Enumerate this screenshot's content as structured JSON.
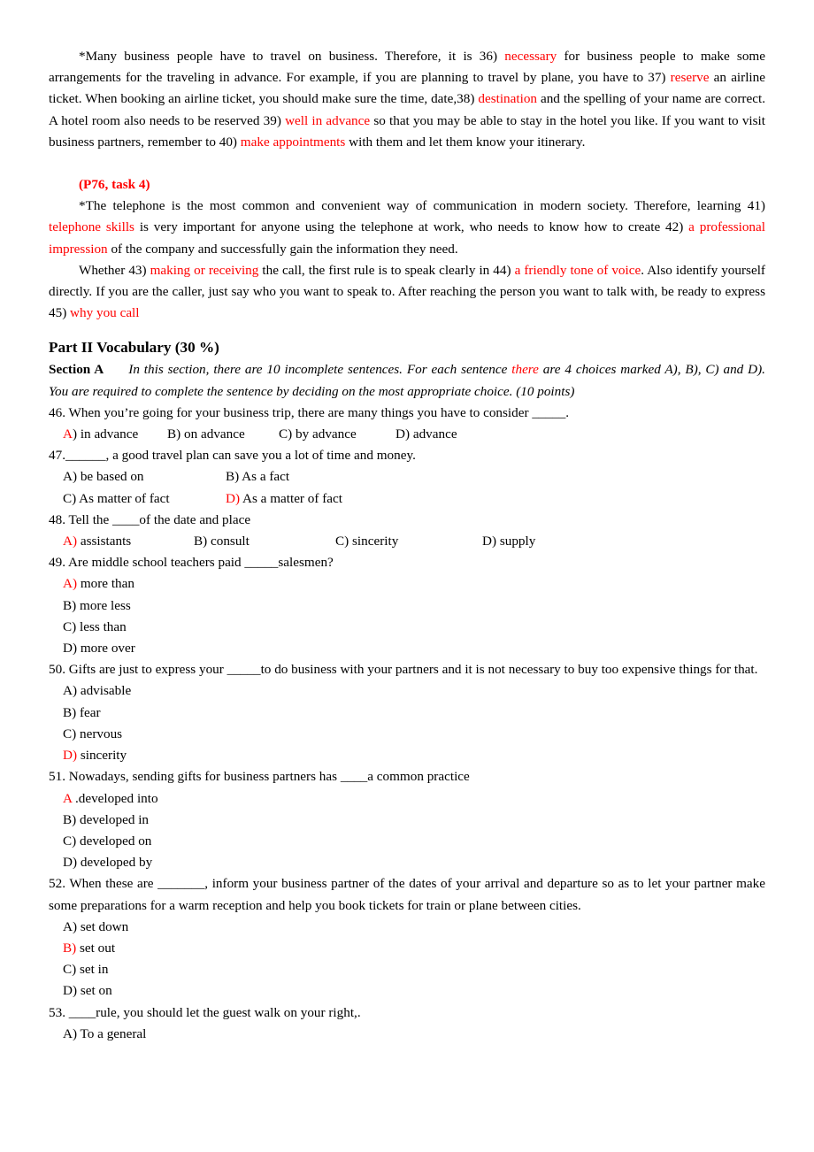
{
  "document": {
    "cloze_one": {
      "segments": [
        {
          "t": "    *Many business people have to travel on business. Therefore, it is 36) ",
          "c": "black"
        },
        {
          "t": "necessary",
          "c": "red"
        },
        {
          "t": " for business people to make some arrangements for the traveling in advance. For example, if you are planning to travel by plane, you have to 37) ",
          "c": "black"
        },
        {
          "t": "reserve",
          "c": "red"
        },
        {
          "t": " an airline ticket. When booking an airline ticket, you should make sure the time, date,38) ",
          "c": "black"
        },
        {
          "t": "destination",
          "c": "red"
        },
        {
          "t": " and the spelling of your name are correct. A hotel room also needs to be reserved 39) ",
          "c": "black"
        },
        {
          "t": "well in advance",
          "c": "red"
        },
        {
          "t": " so that you may be able to stay in the hotel you like. If you want to visit business partners, remember to 40) ",
          "c": "black"
        },
        {
          "t": "make appointments",
          "c": "red"
        },
        {
          "t": " with them and let them know your itinerary.",
          "c": "black"
        }
      ]
    },
    "task_label": "(P76, task 4)",
    "cloze_two": {
      "segments": [
        {
          "t": "    *The telephone is the most common and convenient way of communication in modern society. Therefore, learning 41) ",
          "c": "black"
        },
        {
          "t": "telephone skills",
          "c": "red"
        },
        {
          "t": " is very important for anyone using the telephone at work, who needs to know how to create 42) ",
          "c": "black"
        },
        {
          "t": "a professional impression",
          "c": "red"
        },
        {
          "t": " of the company and successfully gain the information they need.",
          "c": "black"
        }
      ]
    },
    "cloze_three": {
      "segments": [
        {
          "t": "    Whether 43) ",
          "c": "black"
        },
        {
          "t": "making or receiving",
          "c": "red"
        },
        {
          "t": " the call, the first rule is to speak clearly in 44) ",
          "c": "black"
        },
        {
          "t": "a friendly tone of voice",
          "c": "red"
        },
        {
          "t": ". Also identify yourself directly. If you are the caller, just say who you want to speak to. After reaching the person you want to talk with, be ready to express 45) ",
          "c": "black"
        },
        {
          "t": "why you call",
          "c": "red"
        }
      ]
    },
    "part_heading": "Part II Vocabulary (30 %)",
    "section": {
      "label": "Section A",
      "instruction_segments": [
        {
          "t": "In this section, there are 10 incomplete sentences. For each sentence ",
          "c": "black"
        },
        {
          "t": "there",
          "c": "red"
        },
        {
          "t": " are 4 choices marked A), B), C) and D). You are required to complete the sentence by deciding on the most appropriate choice. (10 points)",
          "c": "black"
        }
      ]
    },
    "questions": [
      {
        "number": "46.",
        "stem": "46. When you’re going for your business trip, there are many things you have to consider _____.",
        "layout": "inline",
        "options": [
          {
            "marker": "A",
            "marker_red": true,
            "paren": ")",
            "paren_red": false,
            "text": " in advance",
            "pad": 8
          },
          {
            "marker": "B",
            "marker_red": false,
            "paren": ")",
            "paren_red": false,
            "text": " on advance",
            "pad": 12
          },
          {
            "marker": "C",
            "marker_red": false,
            "paren": ")",
            "paren_red": false,
            "text": " by advance",
            "pad": 12
          },
          {
            "marker": "D",
            "marker_red": false,
            "paren": ")",
            "paren_red": false,
            "text": " advance",
            "pad": 0
          }
        ],
        "inline_text": "A) in advance      B) on advance      C) by advance      D) advance"
      },
      {
        "number": "47.",
        "stem": "47.______, a good travel plan can save you a lot of time and money.",
        "layout": "grid2",
        "options": [
          {
            "marker": "A",
            "marker_red": false,
            "paren": ")",
            "paren_red": false,
            "text": " be based on"
          },
          {
            "marker": "B",
            "marker_red": false,
            "paren": ")",
            "paren_red": false,
            "text": " As a fact"
          },
          {
            "marker": "C",
            "marker_red": false,
            "paren": ")",
            "paren_red": false,
            "text": " As matter of fact"
          },
          {
            "marker": "D",
            "marker_red": true,
            "paren": ")",
            "paren_red": true,
            "text": " As a matter of fact"
          }
        ]
      },
      {
        "number": "48.",
        "stem": "48. Tell the ____of the date and place",
        "layout": "inline",
        "options": [
          {
            "marker": "A",
            "marker_red": true,
            "paren": ")",
            "paren_red": true,
            "text": " assistants"
          },
          {
            "marker": "B",
            "marker_red": false,
            "paren": ")",
            "paren_red": false,
            "text": " consult"
          },
          {
            "marker": "C",
            "marker_red": false,
            "paren": ")",
            "paren_red": false,
            "text": " sincerity"
          },
          {
            "marker": "D",
            "marker_red": false,
            "paren": ")",
            "paren_red": false,
            "text": " supply"
          }
        ]
      },
      {
        "number": "49.",
        "stem": "49. Are middle school teachers paid _____salesmen?",
        "layout": "stack",
        "options": [
          {
            "marker": "A",
            "marker_red": true,
            "paren": ")",
            "paren_red": true,
            "text": " more than"
          },
          {
            "marker": "B",
            "marker_red": false,
            "paren": ")",
            "paren_red": false,
            "text": " more less"
          },
          {
            "marker": "C",
            "marker_red": false,
            "paren": ")",
            "paren_red": false,
            "text": " less than"
          },
          {
            "marker": "D",
            "marker_red": false,
            "paren": ")",
            "paren_red": false,
            "text": " more over"
          }
        ]
      },
      {
        "number": "50.",
        "stem": "50. Gifts are just to express your _____to do business with your partners and it is not necessary to buy too expensive things for that.",
        "layout": "stack",
        "options": [
          {
            "marker": "A",
            "marker_red": false,
            "paren": ")",
            "paren_red": false,
            "text": " advisable"
          },
          {
            "marker": "B",
            "marker_red": false,
            "paren": ")",
            "paren_red": false,
            "text": " fear"
          },
          {
            "marker": "C",
            "marker_red": false,
            "paren": ")",
            "paren_red": false,
            "text": " nervous"
          },
          {
            "marker": "D",
            "marker_red": true,
            "paren": ")",
            "paren_red": true,
            "text": " sincerity"
          }
        ]
      },
      {
        "number": "51.",
        "stem": "51. Nowadays, sending gifts for business partners has ____a common practice",
        "layout": "stack",
        "options": [
          {
            "marker": "A",
            "marker_red": true,
            "paren": "",
            "paren_red": false,
            "text": " .developed into"
          },
          {
            "marker": "B",
            "marker_red": false,
            "paren": ")",
            "paren_red": false,
            "text": " developed in"
          },
          {
            "marker": "C",
            "marker_red": false,
            "paren": ")",
            "paren_red": false,
            "text": " developed on"
          },
          {
            "marker": "D",
            "marker_red": false,
            "paren": ")",
            "paren_red": false,
            "text": " developed by"
          }
        ]
      },
      {
        "number": "52.",
        "stem": "52. When these are _______, inform your business partner of the dates of your arrival and departure so as to let your partner make some preparations for a warm reception and help you book tickets for train or plane between cities.",
        "layout": "stack",
        "options": [
          {
            "marker": "A",
            "marker_red": false,
            "paren": ")",
            "paren_red": false,
            "text": " set down"
          },
          {
            "marker": "B",
            "marker_red": true,
            "paren": ")",
            "paren_red": true,
            "text": " set out"
          },
          {
            "marker": "C",
            "marker_red": false,
            "paren": ")",
            "paren_red": false,
            "text": " set in"
          },
          {
            "marker": "D",
            "marker_red": false,
            "paren": ")",
            "paren_red": false,
            "text": " set on"
          }
        ]
      },
      {
        "number": "53.",
        "stem": "53. ____rule, you should let the guest walk on your right,.",
        "layout": "stack",
        "options": [
          {
            "marker": "A",
            "marker_red": false,
            "paren": ")",
            "paren_red": false,
            "text": " To a general"
          }
        ]
      }
    ]
  },
  "colors": {
    "answer_red": "#ff0000",
    "body_black": "#000000",
    "page_background": "#ffffff"
  }
}
